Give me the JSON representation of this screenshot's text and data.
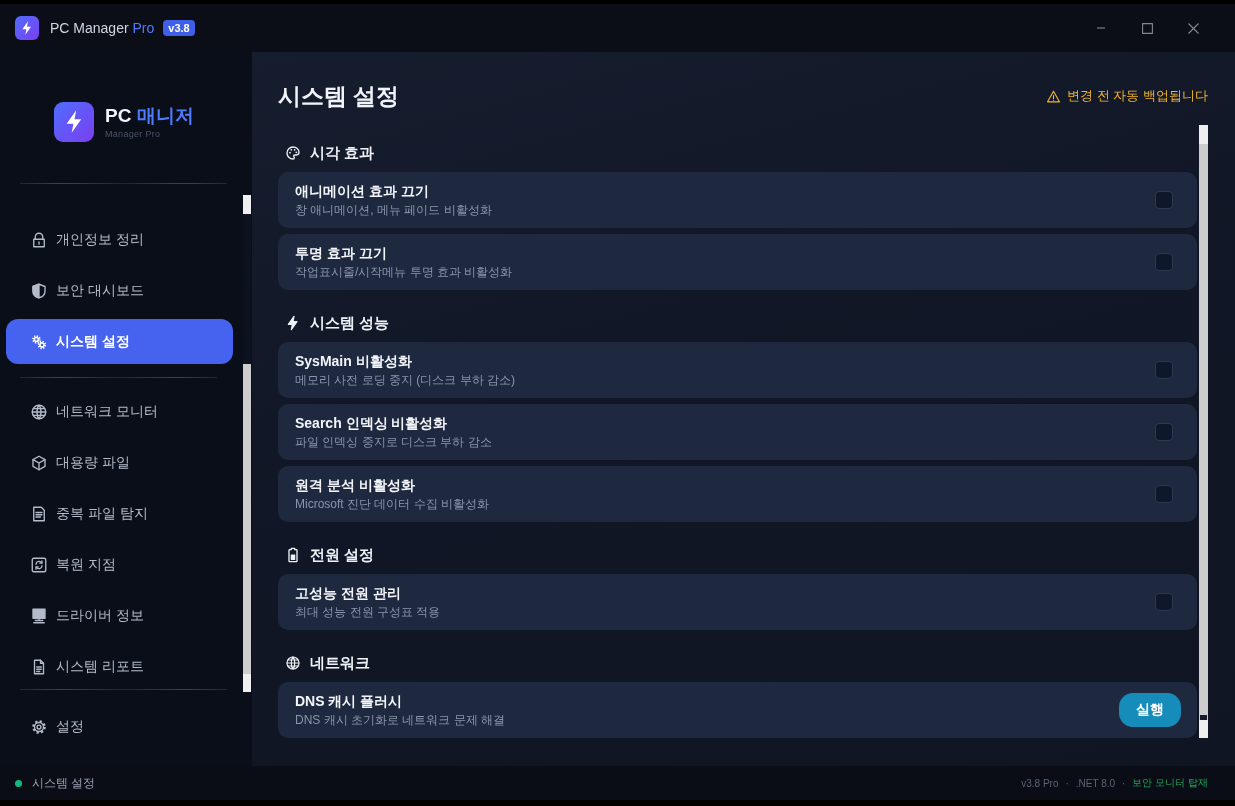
{
  "window": {
    "title": "PC Manager",
    "title_accent": "Pro",
    "version": "v3.8"
  },
  "sidebar": {
    "brand": {
      "name": "PC",
      "name_accent": "매니저",
      "subtitle": "Manager Pro"
    },
    "groups": [
      {
        "items": [
          {
            "label": "개인정보 정리",
            "selected": false
          },
          {
            "label": "보안 대시보드",
            "selected": false
          },
          {
            "label": "시스템 설정",
            "selected": true
          }
        ]
      },
      {
        "items": [
          {
            "label": "네트워크 모니터",
            "selected": false
          },
          {
            "label": "대용량 파일",
            "selected": false
          },
          {
            "label": "중복 파일 탐지",
            "selected": false
          },
          {
            "label": "복원 지점",
            "selected": false
          },
          {
            "label": "드라이버 정보",
            "selected": false
          },
          {
            "label": "시스템 리포트",
            "selected": false
          }
        ]
      }
    ],
    "footer_item": {
      "label": "설정",
      "selected": false
    }
  },
  "main": {
    "title": "시스템 설정",
    "notice": "변경 전 자동 백업됩니다",
    "sections": [
      {
        "title": "시각 효과",
        "items": [
          {
            "kind": "checkbox",
            "title": "애니메이션 효과 끄기",
            "description": "창 애니메이션, 메뉴 페이드 비활성화",
            "checked": false
          },
          {
            "kind": "checkbox",
            "title": "투명 효과 끄기",
            "description": "작업표시줄/시작메뉴 투명 효과 비활성화",
            "checked": false
          }
        ]
      },
      {
        "title": "시스템 성능",
        "items": [
          {
            "kind": "checkbox",
            "title": "SysMain 비활성화",
            "description": "메모리 사전 로딩 중지 (디스크 부하 감소)",
            "checked": false
          },
          {
            "kind": "checkbox",
            "title": "Search 인덱싱 비활성화",
            "description": "파일 인덱싱 중지로 디스크 부하 감소",
            "checked": false
          },
          {
            "kind": "checkbox",
            "title": "원격 분석 비활성화",
            "description": "Microsoft 진단 데이터 수집 비활성화",
            "checked": false
          }
        ]
      },
      {
        "title": "전원 설정",
        "items": [
          {
            "kind": "checkbox",
            "title": "고성능 전원 관리",
            "description": "최대 성능 전원 구성표 적용",
            "checked": false
          }
        ]
      },
      {
        "title": "네트워크",
        "items": [
          {
            "kind": "action",
            "title": "DNS 캐시 플러시",
            "description": "DNS 캐시 초기화로 네트워크 문제 해결",
            "button": "실행"
          }
        ]
      }
    ]
  },
  "status_bar": {
    "status": "시스템 설정",
    "meta": [
      {
        "kind": "info",
        "text": "v3.8 Pro"
      },
      {
        "kind": "separator",
        "text": "·"
      },
      {
        "kind": "info",
        "text": ".NET 8.0"
      },
      {
        "kind": "separator",
        "text": "·"
      },
      {
        "kind": "highlight",
        "text": "보안 모니터 탑재"
      }
    ]
  }
}
